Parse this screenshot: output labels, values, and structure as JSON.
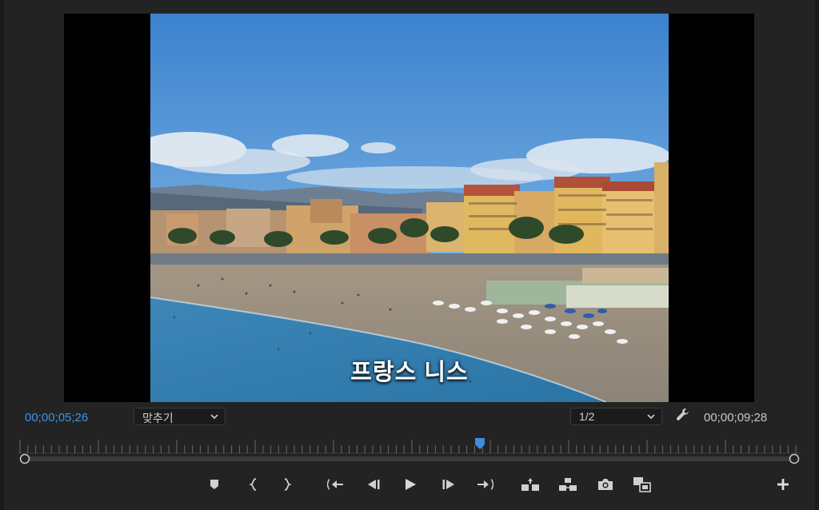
{
  "viewer": {
    "subtitle": "프랑스 니스"
  },
  "timecode": {
    "current": "00;00;05;26",
    "duration": "00;00;09;28"
  },
  "zoom_select": {
    "value": "맞추기"
  },
  "resolution_select": {
    "value": "1/2"
  },
  "playhead": {
    "position_fraction": 0.59
  },
  "controls": [
    {
      "name": "add-marker-button",
      "icon": "marker-icon"
    },
    {
      "name": "mark-in-button",
      "icon": "mark-in-icon"
    },
    {
      "name": "mark-out-button",
      "icon": "mark-out-icon"
    },
    {
      "name": "go-to-in-button",
      "icon": "go-to-in-icon"
    },
    {
      "name": "step-back-button",
      "icon": "step-back-icon"
    },
    {
      "name": "play-button",
      "icon": "play-icon"
    },
    {
      "name": "step-forward-button",
      "icon": "step-forward-icon"
    },
    {
      "name": "go-to-out-button",
      "icon": "go-to-out-icon"
    },
    {
      "name": "lift-button",
      "icon": "lift-icon"
    },
    {
      "name": "extract-button",
      "icon": "extract-icon"
    },
    {
      "name": "export-frame-button",
      "icon": "camera-icon"
    },
    {
      "name": "comparison-view-button",
      "icon": "comparison-view-icon"
    },
    {
      "name": "button-editor-button",
      "icon": "plus-icon"
    }
  ],
  "colors": {
    "accent_blue": "#3d95e6",
    "panel_bg": "#232323"
  }
}
